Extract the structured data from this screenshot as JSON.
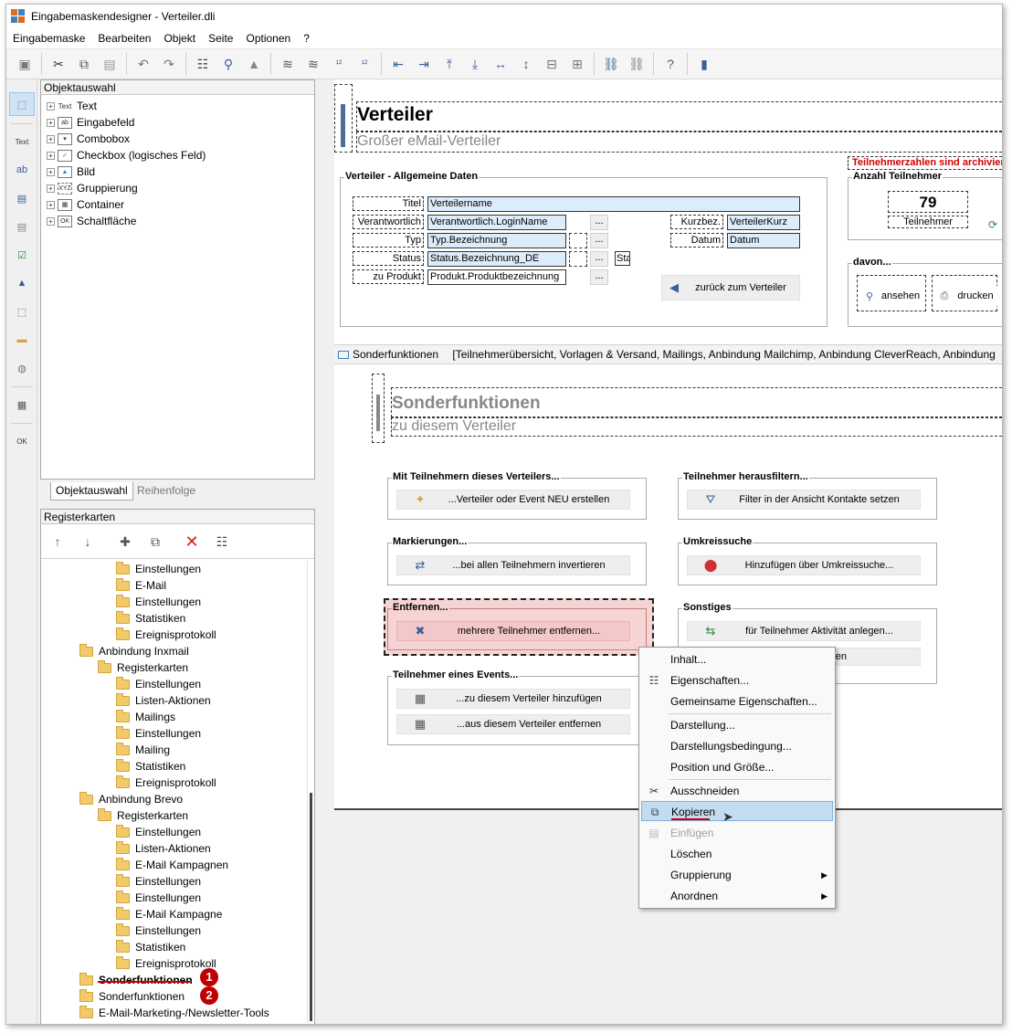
{
  "window": {
    "title": "Eingabemaskendesigner - Verteiler.dli"
  },
  "menu": [
    "Eingabemaske",
    "Bearbeiten",
    "Objekt",
    "Seite",
    "Optionen",
    "?"
  ],
  "sidebar_text_button": "Text",
  "sidebar_ok_button": "OK",
  "object_panel": {
    "title": "Objektauswahl",
    "items": [
      {
        "icon": "Text",
        "label": "Text"
      },
      {
        "icon": "ab",
        "label": "Eingabefeld"
      },
      {
        "icon": "▾",
        "label": "Combobox"
      },
      {
        "icon": "✓",
        "label": "Checkbox (logisches Feld)"
      },
      {
        "icon": "▲",
        "label": "Bild"
      },
      {
        "icon": "XYZ",
        "label": "Gruppierung"
      },
      {
        "icon": "▦",
        "label": "Container"
      },
      {
        "icon": "OK",
        "label": "Schaltfläche"
      }
    ],
    "tabs": [
      "Objektauswahl",
      "Reihenfolge"
    ]
  },
  "register_panel": {
    "title": "Registerkarten",
    "items": [
      {
        "label": "Einstellungen",
        "level": 3
      },
      {
        "label": "E-Mail",
        "level": 3
      },
      {
        "label": "Einstellungen",
        "level": 3
      },
      {
        "label": "Statistiken",
        "level": 3
      },
      {
        "label": "Ereignisprotokoll",
        "level": 3
      },
      {
        "label": "Anbindung Inxmail",
        "level": 1
      },
      {
        "label": "Registerkarten",
        "level": 2
      },
      {
        "label": "Einstellungen",
        "level": 3
      },
      {
        "label": "Listen-Aktionen",
        "level": 3
      },
      {
        "label": "Mailings",
        "level": 3
      },
      {
        "label": "Einstellungen",
        "level": 3
      },
      {
        "label": "Mailing",
        "level": 3
      },
      {
        "label": "Statistiken",
        "level": 3
      },
      {
        "label": "Ereignisprotokoll",
        "level": 3
      },
      {
        "label": "Anbindung Brevo",
        "level": 1
      },
      {
        "label": "Registerkarten",
        "level": 2
      },
      {
        "label": "Einstellungen",
        "level": 3
      },
      {
        "label": "Listen-Aktionen",
        "level": 3
      },
      {
        "label": "E-Mail Kampagnen",
        "level": 3
      },
      {
        "label": "Einstellungen",
        "level": 3
      },
      {
        "label": "Einstellungen",
        "level": 3
      },
      {
        "label": "E-Mail Kampagne",
        "level": 3
      },
      {
        "label": "Einstellungen",
        "level": 3
      },
      {
        "label": "Statistiken",
        "level": 3
      },
      {
        "label": "Ereignisprotokoll",
        "level": 3
      },
      {
        "label": "Sonderfunktionen",
        "level": 1
      },
      {
        "label": "Sonderfunktionen",
        "level": 1
      },
      {
        "label": "E-Mail-Marketing-/Newsletter-Tools",
        "level": 1
      }
    ],
    "badges": [
      "1",
      "2"
    ]
  },
  "form": {
    "title": "Verteiler",
    "subtitle": "Großer eMail-Verteiler",
    "warning": "Teilnehmerzahlen sind archivier",
    "general_group": "Verteiler - Allgemeine Daten",
    "labels": {
      "titel": "Titel",
      "verantwortlich": "Verantwortlich",
      "typ": "Typ",
      "status": "Status",
      "produkt": "zu Produkt",
      "kurzbez": "Kurzbez.",
      "datum": "Datum",
      "sta": "Sta"
    },
    "fields": {
      "titel": "Verteilername",
      "verantwortlich": "Verantwortlich.LoginName",
      "typ": "Typ.Bezeichnung",
      "status": "Status.Bezeichnung_DE",
      "produkt": "Produkt.Produktbezeichnung",
      "kurzbez": "VerteilerKurz",
      "datum": "Datum"
    },
    "dots": "...",
    "back_button": "zurück zum Verteiler",
    "count_group": "Anzahl Teilnehmer",
    "count_value": "79",
    "count_label": "Teilnehmer",
    "davon_group": "davon...",
    "view_button": "ansehen",
    "print_button": "drucken",
    "tab_strip": "Sonderfunktionen",
    "tab_strip_detail": "[Teilnehmerübersicht, Vorlagen & Versand, Mailings, Anbindung Mailchimp, Anbindung CleverReach, Anbindung"
  },
  "special": {
    "title": "Sonderfunktionen",
    "subtitle": "zu diesem Verteiler",
    "groups": [
      {
        "title": "Mit Teilnehmern dieses Verteilers...",
        "button": "...Verteiler oder Event NEU erstellen"
      },
      {
        "title": "Teilnehmer herausfiltern...",
        "button": "Filter in der Ansicht Kontakte setzen"
      },
      {
        "title": "Markierungen...",
        "button": "...bei allen Teilnehmern invertieren"
      },
      {
        "title": "Umkreissuche",
        "button": "Hinzufügen über Umkreissuche..."
      },
      {
        "title": "Entfernen...",
        "button": "mehrere Teilnehmer entfernen..."
      },
      {
        "title": "Sonstiges",
        "button": "für Teilnehmer Aktivität anlegen...",
        "button2": "en"
      },
      {
        "title": "Teilnehmer eines Events...",
        "button": "...zu diesem Verteiler hinzufügen",
        "button2": "...aus diesem Verteiler entfernen"
      }
    ]
  },
  "context_menu": {
    "items": [
      "Inhalt...",
      "Eigenschaften...",
      "Gemeinsame Eigenschaften...",
      "Darstellung...",
      "Darstellungsbedingung...",
      "Position und Größe...",
      "Ausschneiden",
      "Kopieren",
      "Einfügen",
      "Löschen",
      "Gruppierung",
      "Anordnen"
    ]
  },
  "colors": {
    "accent": "#4b6e9c",
    "highlight": "#c3dcf2",
    "warning": "#d00000",
    "field": "#dcecfb",
    "selected_group": "#f7d4d4"
  }
}
